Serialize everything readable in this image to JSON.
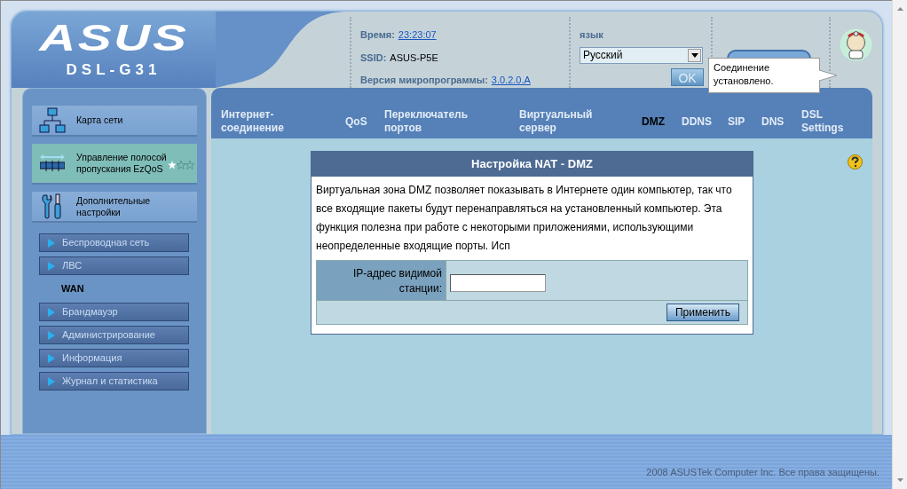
{
  "header": {
    "logo": "ASUS",
    "model": "DSL-G31",
    "time_label": "Время:",
    "time": "23:23:07",
    "ssid_label": "SSID:",
    "ssid": "ASUS-P5E",
    "firmware_label": "Версия микропрограммы:",
    "firmware": "3.0.2.0.A",
    "language_label": "язык",
    "language": "Русский",
    "ok_button": "OK",
    "ok_disabled": true,
    "tooltip": "Соединение установлено."
  },
  "sidebar": {
    "main_items": [
      {
        "kind": "network",
        "label": "Карта сети",
        "selected": false
      },
      {
        "kind": "qos",
        "label": "Управление полосой пропускания EzQoS",
        "selected": true,
        "stars": 1
      },
      {
        "kind": "tools",
        "label": "Дополнительные настройки",
        "selected": false
      }
    ],
    "sub_items": [
      {
        "label": "Беспроводная сеть",
        "selected": false
      },
      {
        "label": "ЛВС",
        "selected": false
      },
      {
        "label": "WAN",
        "selected": true
      },
      {
        "label": "Брандмауэр",
        "selected": false
      },
      {
        "label": "Администрирование",
        "selected": false
      },
      {
        "label": "Информация",
        "selected": false
      },
      {
        "label": "Журнал и статистика",
        "selected": false
      }
    ]
  },
  "tabs": [
    {
      "label": "Интернет-соединение",
      "selected": false
    },
    {
      "label": "QoS",
      "selected": false
    },
    {
      "label": "Переключатель портов",
      "selected": false
    },
    {
      "label": "Виртуальный сервер",
      "selected": false
    },
    {
      "label": "DMZ",
      "selected": true
    },
    {
      "label": "DDNS",
      "selected": false
    },
    {
      "label": "SIP",
      "selected": false
    },
    {
      "label": "DNS",
      "selected": false
    },
    {
      "label": "DSL Settings",
      "selected": false
    }
  ],
  "dialog": {
    "title": "Настройка NAT - DMZ",
    "description": "Виртуальная зона DMZ позволяет показывать в Интернете один компьютер, так что все входящие пакеты будут перенаправляться на установленный компьютер. Эта функция полезна при работе с некоторыми приложениями, использующими неопределенные входящие порты. Исп",
    "ip_label": "IP-адрес видимой станции:",
    "apply_button": "Применить"
  },
  "footer": "2008 ASUSTek Computer Inc. Все права защищены."
}
